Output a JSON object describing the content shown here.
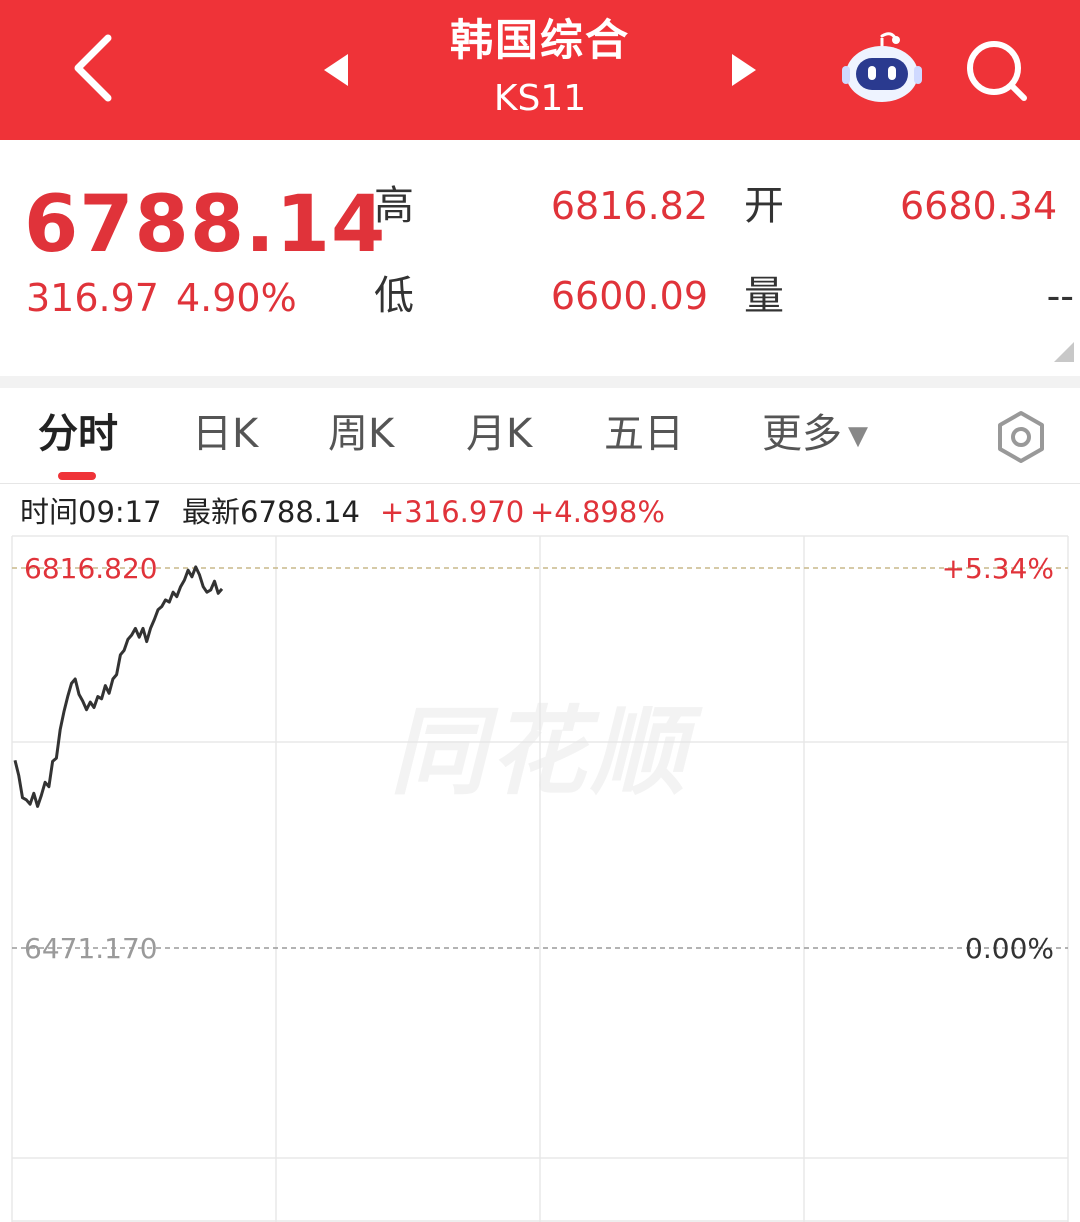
{
  "header": {
    "title": "韩国综合",
    "code": "KS11",
    "icons": {
      "back": "chevron-left-icon",
      "prev": "triangle-left-icon",
      "next": "triangle-right-icon",
      "assistant": "robot-icon",
      "search": "search-icon"
    }
  },
  "quote": {
    "price": "6788.14",
    "change": "316.97",
    "change_pct": "4.90%",
    "high_label": "高",
    "high_value": "6816.82",
    "open_label": "开",
    "open_value": "6680.34",
    "low_label": "低",
    "low_value": "6600.09",
    "volume_label": "量",
    "volume_value": "--"
  },
  "tabs": [
    {
      "label": "分时",
      "active": true
    },
    {
      "label": "日K"
    },
    {
      "label": "周K"
    },
    {
      "label": "月K"
    },
    {
      "label": "五日"
    },
    {
      "label": "更多"
    }
  ],
  "info": {
    "time": "时间09:17",
    "latest": "最新6788.14",
    "change": "+316.970",
    "change_pct": "+4.898%"
  },
  "colors": {
    "brand": "#ef3338",
    "up": "#e0333a",
    "line": "#333333"
  },
  "chart_data": {
    "type": "line",
    "y_top_label": "6816.820",
    "y_mid_label": "6471.170",
    "pct_top_label": "+5.34%",
    "pct_mid_label": "0.00%",
    "watermark": "同花顺",
    "ylim": [
      6126,
      6817
    ],
    "reference_price": 6471.17,
    "series": [
      {
        "values": [
          6642,
          6628,
          6608,
          6606,
          6602,
          6612,
          6600,
          6610,
          6622,
          6618,
          6641,
          6644,
          6670,
          6686,
          6700,
          6712,
          6716,
          6702,
          6696,
          6688,
          6695,
          6690,
          6700,
          6698,
          6710,
          6703,
          6716,
          6720,
          6738,
          6742,
          6752,
          6756,
          6762,
          6754,
          6762,
          6750,
          6762,
          6770,
          6779,
          6782,
          6788,
          6786,
          6795,
          6791,
          6800,
          6806,
          6815,
          6809,
          6818,
          6811,
          6800,
          6795,
          6797,
          6805,
          6794,
          6798
        ]
      }
    ]
  }
}
